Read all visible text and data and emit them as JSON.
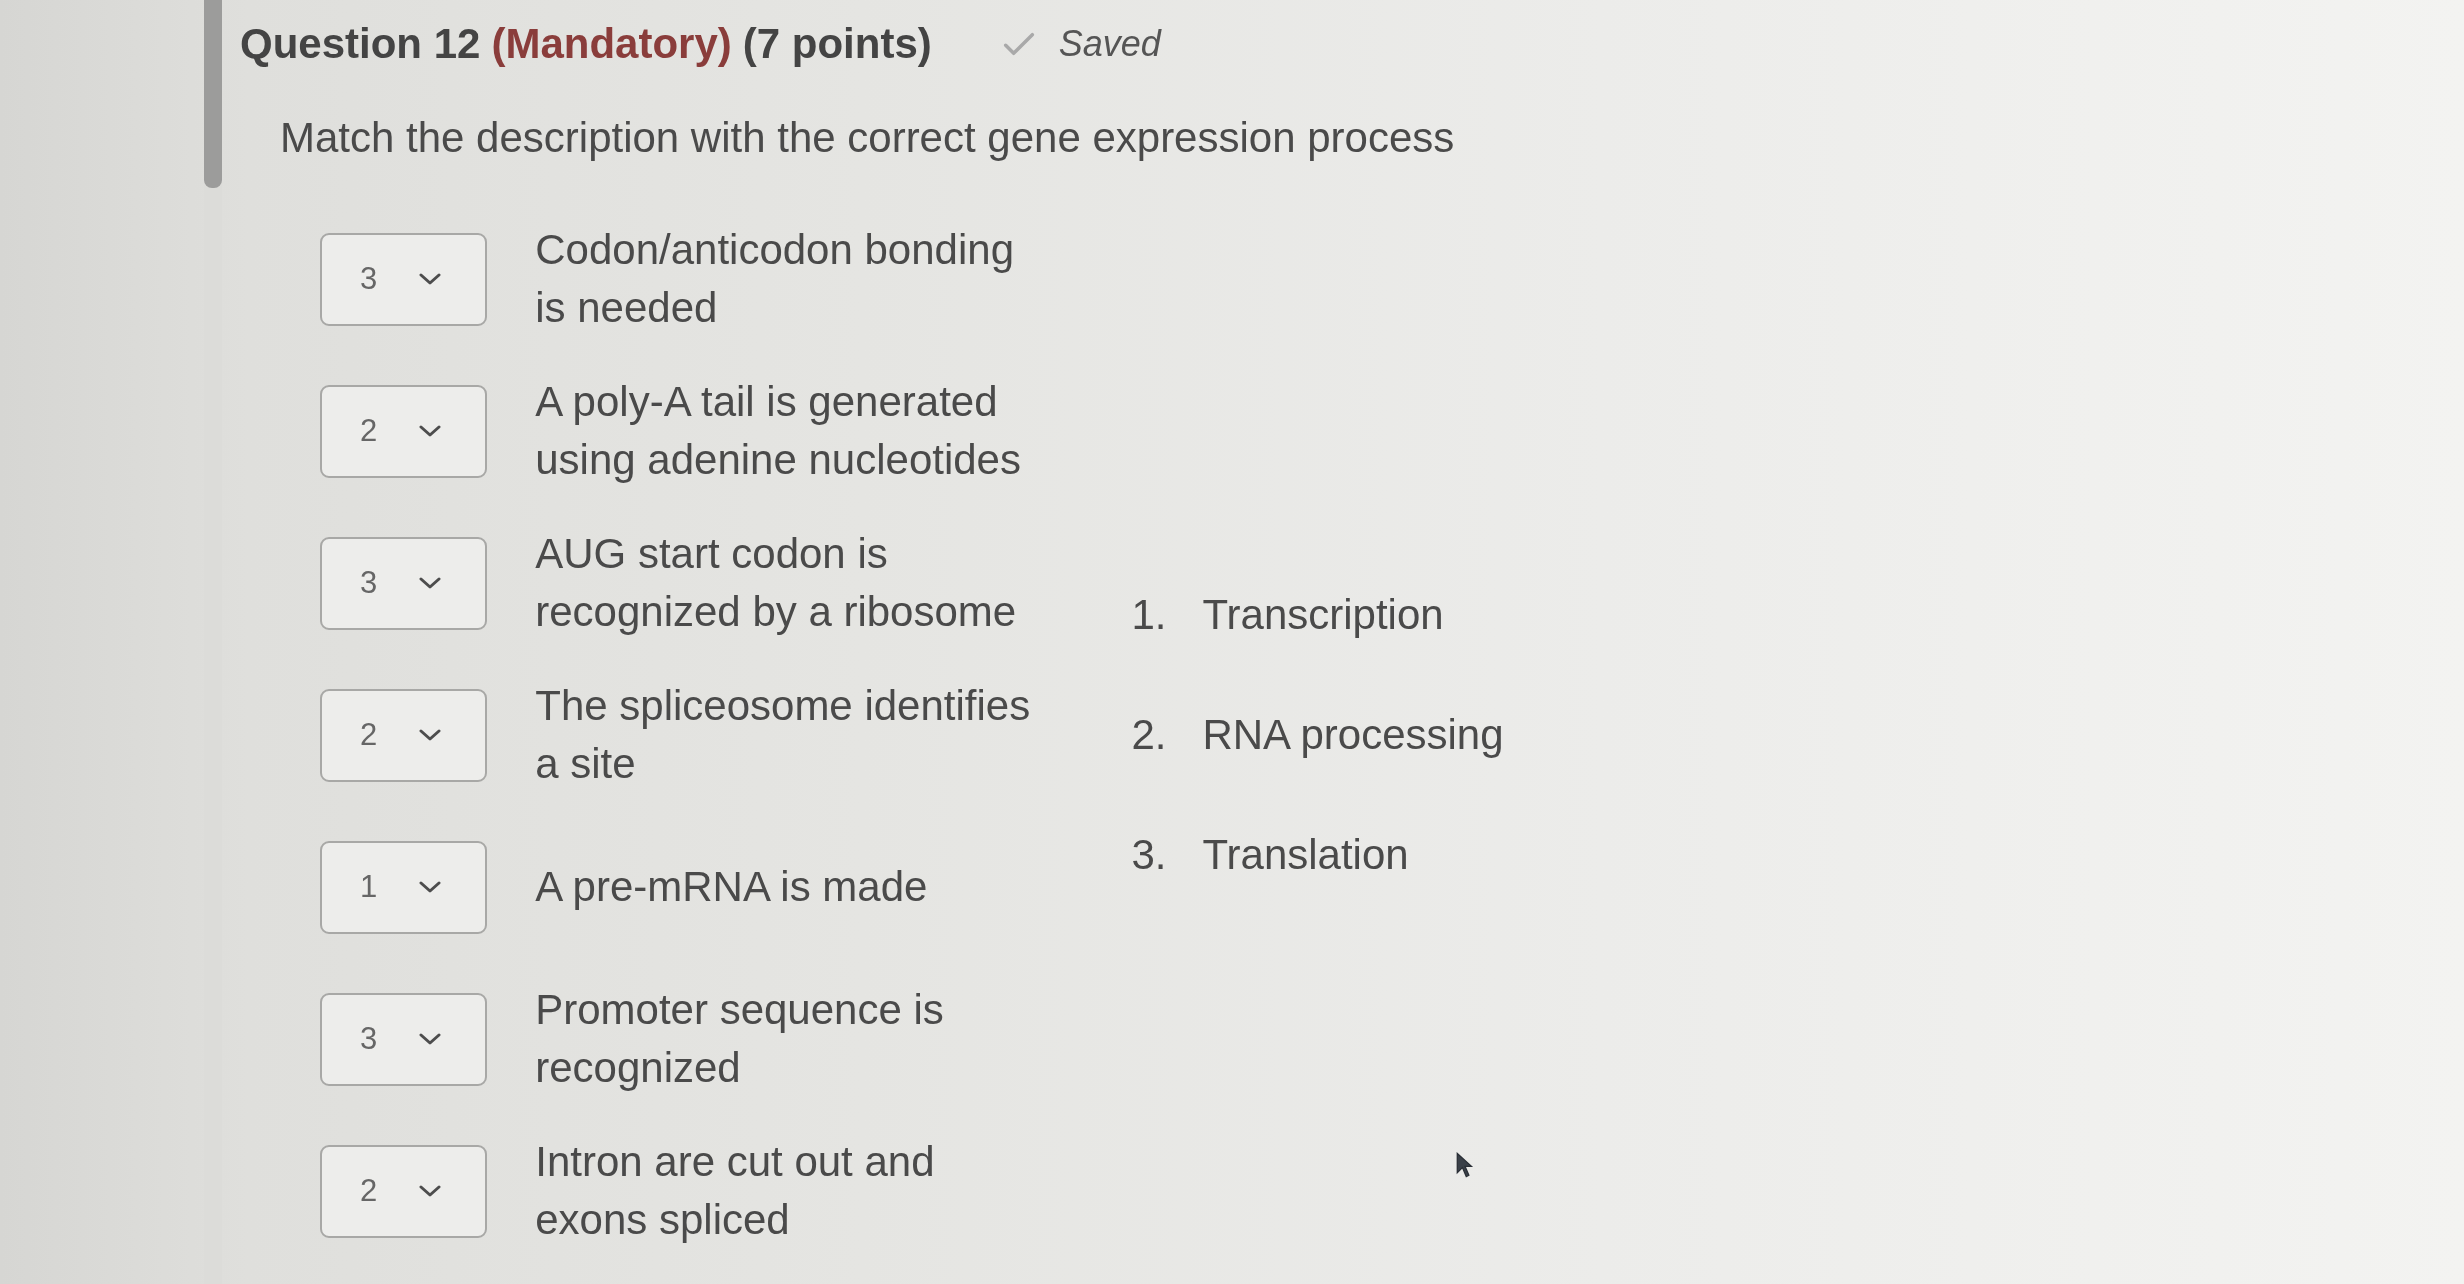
{
  "question": {
    "title": "Question 12",
    "mandatory": "(Mandatory)",
    "points": "(7 points)",
    "save_status": "Saved"
  },
  "prompt": "Match the description with the correct gene expression process",
  "matches": [
    {
      "value": "3",
      "description": "Codon/anticodon bonding is needed"
    },
    {
      "value": "2",
      "description": "A poly-A tail is generated using adenine nucleotides"
    },
    {
      "value": "3",
      "description": "AUG start codon is recognized by a ribosome"
    },
    {
      "value": "2",
      "description": "The spliceosome identifies a site"
    },
    {
      "value": "1",
      "description": "A pre-mRNA is made"
    },
    {
      "value": "3",
      "description": "Promoter sequence is recognized"
    },
    {
      "value": "2",
      "description": "Intron are cut out and exons spliced"
    }
  ],
  "options": [
    {
      "number": "1.",
      "label": "Transcription"
    },
    {
      "number": "2.",
      "label": "RNA processing"
    },
    {
      "number": "3.",
      "label": "Translation"
    }
  ]
}
